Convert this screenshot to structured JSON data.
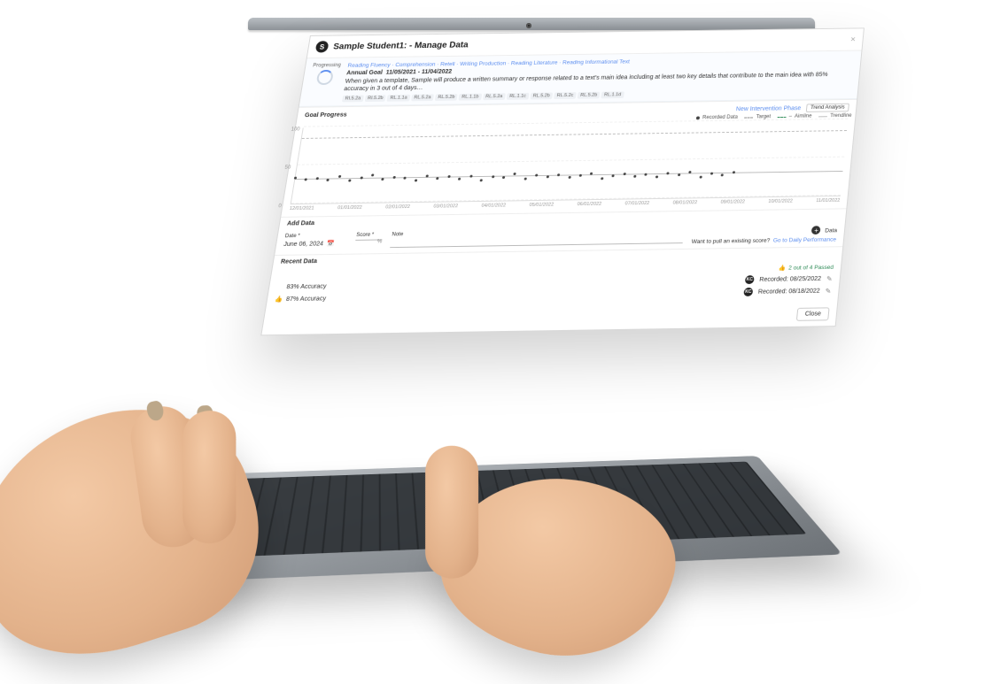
{
  "header": {
    "avatar_initial": "S",
    "title": "Sample Student1:  - Manage Data",
    "close_x": "×"
  },
  "status": {
    "label": "Progressing"
  },
  "goal": {
    "breadcrumbs": "Reading Fluency · Comprehension · Retell · Writing Production · Reading Literature · Reading Informational Text",
    "label_prefix": "Annual Goal",
    "date_range": "11/05/2021  -  11/04/2022",
    "description": "When given a template, Sample will produce a written summary or response related to a text's main idea including at least two key details that contribute to the main idea with 85% accuracy in 3 out of 4 days…",
    "standards": [
      "RI.5.2a",
      "RI.5.2b",
      "RL.1.1a",
      "RL.5.2a",
      "RL.5.2b",
      "RL.1.1b",
      "RL.5.2a",
      "RL.1.1c",
      "RL.5.2b",
      "RL.5.2c",
      "RL.5.2b",
      "RL.1.1d"
    ]
  },
  "chart": {
    "title": "Goal Progress",
    "link_new_phase": "New Intervention Phase",
    "btn_trend": "Trend Analysis",
    "legend": {
      "recorded": "Recorded Data",
      "target": "Target",
      "aimline": "Aimline",
      "trendline": "Trendline"
    }
  },
  "chart_data": {
    "type": "scatter",
    "ylim": [
      0,
      100
    ],
    "yticks": [
      0,
      50,
      100
    ],
    "target": 85,
    "aimline": {
      "start_y": 32,
      "end_y": 30
    },
    "trendline": {
      "start_y": 34,
      "end_y": 28
    },
    "x_labels": [
      "12/01/2021",
      "01/01/2022",
      "02/01/2022",
      "03/01/2022",
      "04/01/2022",
      "05/01/2022",
      "06/01/2022",
      "07/01/2022",
      "08/01/2022",
      "09/01/2022",
      "10/01/2022",
      "11/01/2022"
    ],
    "points": [
      {
        "x": 0.0,
        "y": 34
      },
      {
        "x": 0.02,
        "y": 31
      },
      {
        "x": 0.04,
        "y": 33
      },
      {
        "x": 0.06,
        "y": 30
      },
      {
        "x": 0.08,
        "y": 35
      },
      {
        "x": 0.1,
        "y": 29
      },
      {
        "x": 0.12,
        "y": 32
      },
      {
        "x": 0.14,
        "y": 36
      },
      {
        "x": 0.16,
        "y": 30
      },
      {
        "x": 0.18,
        "y": 33
      },
      {
        "x": 0.2,
        "y": 31
      },
      {
        "x": 0.22,
        "y": 28
      },
      {
        "x": 0.24,
        "y": 34
      },
      {
        "x": 0.26,
        "y": 30
      },
      {
        "x": 0.28,
        "y": 32
      },
      {
        "x": 0.3,
        "y": 29
      },
      {
        "x": 0.32,
        "y": 33
      },
      {
        "x": 0.34,
        "y": 27
      },
      {
        "x": 0.36,
        "y": 31
      },
      {
        "x": 0.38,
        "y": 30
      },
      {
        "x": 0.4,
        "y": 35
      },
      {
        "x": 0.42,
        "y": 28
      },
      {
        "x": 0.44,
        "y": 32
      },
      {
        "x": 0.46,
        "y": 30
      },
      {
        "x": 0.48,
        "y": 33
      },
      {
        "x": 0.5,
        "y": 29
      },
      {
        "x": 0.52,
        "y": 31
      },
      {
        "x": 0.54,
        "y": 34
      },
      {
        "x": 0.56,
        "y": 27
      },
      {
        "x": 0.58,
        "y": 30
      },
      {
        "x": 0.6,
        "y": 32
      },
      {
        "x": 0.62,
        "y": 29
      },
      {
        "x": 0.64,
        "y": 31
      },
      {
        "x": 0.66,
        "y": 28
      },
      {
        "x": 0.68,
        "y": 33
      },
      {
        "x": 0.7,
        "y": 30
      },
      {
        "x": 0.72,
        "y": 34
      },
      {
        "x": 0.74,
        "y": 27
      },
      {
        "x": 0.76,
        "y": 31
      },
      {
        "x": 0.78,
        "y": 29
      },
      {
        "x": 0.8,
        "y": 32
      }
    ]
  },
  "add_data": {
    "section_title": "Add Data",
    "date_label": "Date *",
    "date_value": "June 06, 2024",
    "score_label": "Score *",
    "score_value": "",
    "note_label": "Note",
    "plus_label": "Data",
    "pull_prompt": "Want to pull an existing score?",
    "pull_link": "Go to Daily Performance"
  },
  "recent": {
    "section_title": "Recent Data",
    "passed_summary": "2 out of 4 Passed",
    "items": [
      {
        "accuracy": "83% Accuracy",
        "thumb": "neutral",
        "badge": "KC",
        "recorded": "Recorded: 08/25/2022"
      },
      {
        "accuracy": "87% Accuracy",
        "thumb": "up",
        "badge": "KC",
        "recorded": "Recorded: 08/18/2022"
      }
    ]
  },
  "footer": {
    "close": "Close"
  }
}
